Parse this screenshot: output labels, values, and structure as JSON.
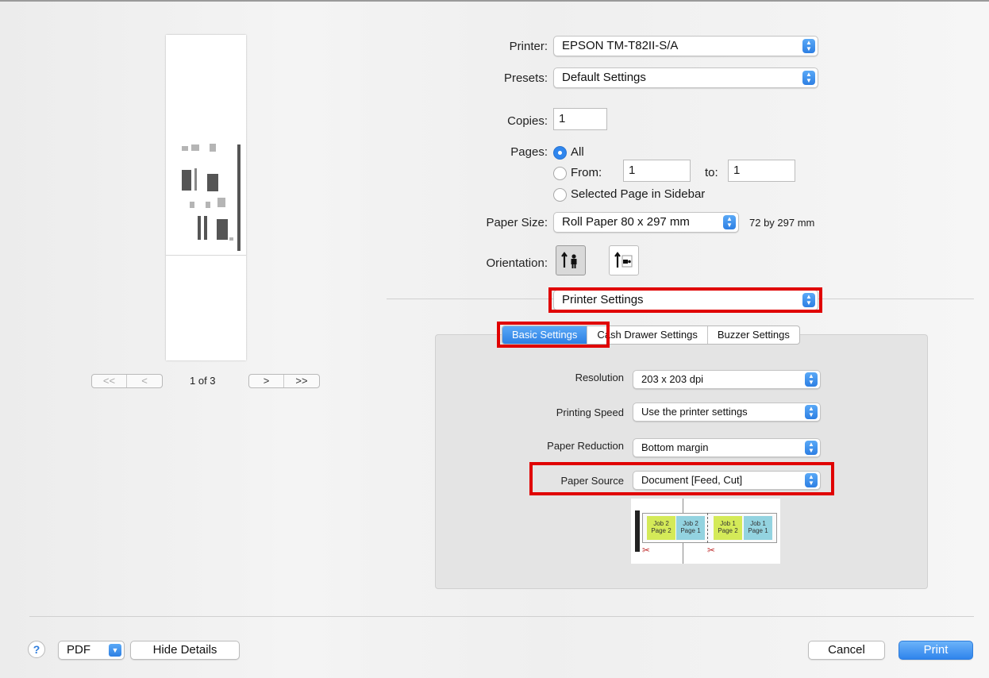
{
  "preview": {
    "page_count": "1 of 3",
    "nav": {
      "first": "<<",
      "prev": "<",
      "next": ">",
      "last": ">>"
    }
  },
  "printer": {
    "label": "Printer:",
    "value": "EPSON TM-T82II-S/A"
  },
  "presets": {
    "label": "Presets:",
    "value": "Default Settings"
  },
  "copies": {
    "label": "Copies:",
    "value": "1"
  },
  "pages": {
    "label": "Pages:",
    "all": "All",
    "from": "From:",
    "from_value": "1",
    "to": "to:",
    "to_value": "1",
    "selected": "Selected Page in Sidebar",
    "selected_option": "All"
  },
  "paper_size": {
    "label": "Paper Size:",
    "value": "Roll Paper 80 x 297 mm",
    "dimensions": "72 by 297 mm"
  },
  "orientation": {
    "label": "Orientation:",
    "selected": "portrait"
  },
  "section_popup": {
    "value": "Printer Settings"
  },
  "tabs": [
    {
      "label": "Basic Settings",
      "active": true
    },
    {
      "label": "Cash Drawer Settings",
      "active": false
    },
    {
      "label": "Buzzer Settings",
      "active": false
    }
  ],
  "basic": {
    "resolution": {
      "label": "Resolution",
      "value": "203 x 203 dpi"
    },
    "speed": {
      "label": "Printing Speed",
      "value": "Use the printer settings"
    },
    "reduction": {
      "label": "Paper Reduction",
      "value": "Bottom margin"
    },
    "source": {
      "label": "Paper Source",
      "value": "Document [Feed, Cut]"
    }
  },
  "diagram": {
    "jobs": [
      {
        "l1": "Job 2",
        "l2": "Page 2",
        "color": "green"
      },
      {
        "l1": "Job 2",
        "l2": "Page 1",
        "color": "blue"
      },
      {
        "l1": "Job 1",
        "l2": "Page 2",
        "color": "green"
      },
      {
        "l1": "Job 1",
        "l2": "Page 1",
        "color": "blue"
      }
    ]
  },
  "footer": {
    "help": "?",
    "pdf": "PDF",
    "hide_details": "Hide Details",
    "cancel": "Cancel",
    "print": "Print"
  },
  "colors": {
    "accent": "#2f84ec",
    "highlight": "#e00000"
  }
}
